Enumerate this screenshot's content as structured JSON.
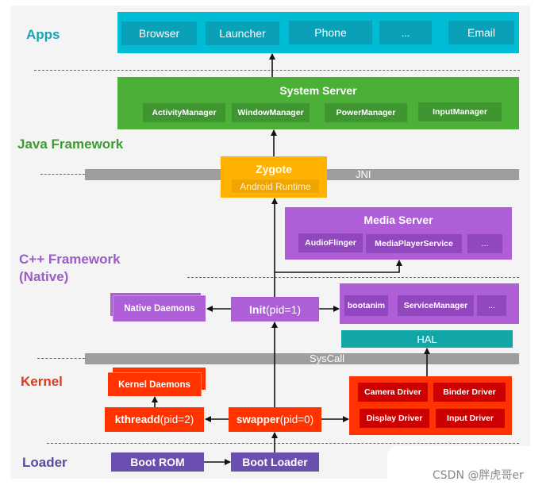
{
  "layers": {
    "apps": "Apps",
    "java": "Java Framework",
    "cpp_line1": "C++ Framework",
    "cpp_line2": "(Native)",
    "kernel": "Kernel",
    "loader": "Loader"
  },
  "colors": {
    "apps": "#00bcd4",
    "java": "#4caf38",
    "zygote": "#ffb300",
    "native": "#ae5fd8",
    "hal": "#12a6a6",
    "kernel": "#ff3300",
    "loader": "#6a4fb0",
    "bar": "#9e9e9e"
  },
  "apps": [
    "Browser",
    "Launcher",
    "Phone",
    "...",
    "Email"
  ],
  "system_server": {
    "title": "System Server",
    "items": [
      "ActivityManager",
      "WindowManager",
      "PowerManager",
      "InputManager"
    ]
  },
  "zygote": {
    "title": "Zygote",
    "sub": "Android Runtime"
  },
  "jni": "JNI",
  "media_server": {
    "title": "Media Server",
    "items": [
      "AudioFlinger",
      "MediaPlayerService",
      "..."
    ]
  },
  "native_daemons": "Native Daemons",
  "init": {
    "bold": "Init",
    "rest": "(pid=1)"
  },
  "native_services": [
    "bootanim",
    "ServiceManager",
    "..."
  ],
  "hal": "HAL",
  "syscall": "SysCall",
  "kernel_daemons": "Kernel Daemons",
  "kthreadd": {
    "bold": "kthreadd",
    "rest": "(pid=2)"
  },
  "swapper": {
    "bold": "swapper",
    "rest": "(pid=0)"
  },
  "drivers": [
    "Camera Driver",
    "Binder Driver",
    "Display Driver",
    "Input Driver"
  ],
  "boot_rom": "Boot ROM",
  "boot_loader": "Boot Loader",
  "watermark": "CSDN @胖虎哥er"
}
